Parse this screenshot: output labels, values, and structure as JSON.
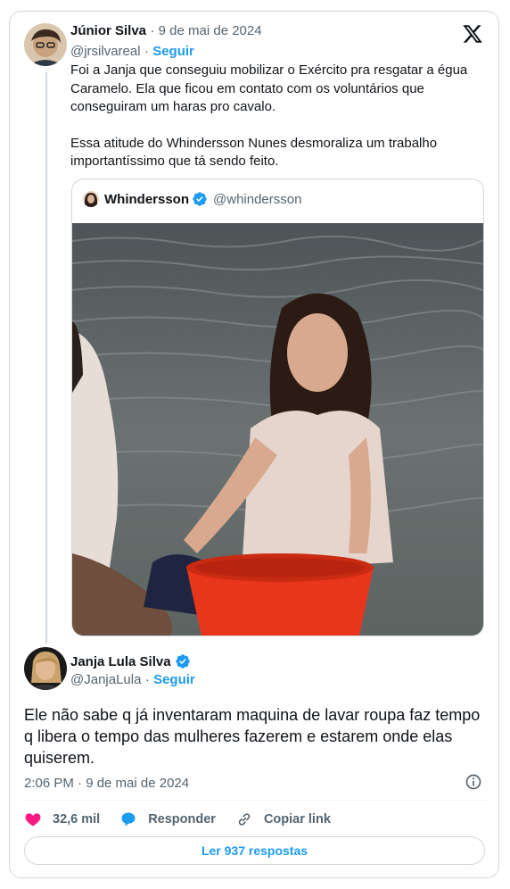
{
  "parent_tweet": {
    "author_name": "Júnior Silva",
    "date": "9 de mai de 2024",
    "handle": "@jrsilvareal",
    "follow_label": "Seguir",
    "paragraphs": [
      "Foi a Janja que conseguiu mobilizar o Exército pra resgatar a égua Caramelo. Ela que ficou em contato com os voluntários que conseguiram um haras pro cavalo.",
      "Essa atitude do Whindersson Nunes desmoraliza um trabalho importantíssimo que tá sendo feito."
    ],
    "quoted": {
      "author_name": "Whindersson",
      "handle": "@whindersson"
    }
  },
  "main_tweet": {
    "author_name": "Janja Lula Silva",
    "handle": "@JanjaLula",
    "follow_label": "Seguir",
    "text": "Ele não sabe q já inventaram maquina de lavar roupa faz tempo q libera o tempo das mulheres fazerem e estarem onde elas quiserem.",
    "timestamp": "2:06 PM · 9 de mai de 2024",
    "likes": "32,6 mil",
    "reply_label": "Responder",
    "copy_link_label": "Copiar link",
    "read_replies_label": "Ler 937 respostas"
  },
  "icons": {
    "brand": "x-logo-icon",
    "verified": "verified-badge-icon",
    "like": "heart-icon",
    "reply": "speech-bubble-icon",
    "copy": "link-icon",
    "info": "info-icon"
  },
  "colors": {
    "accent": "#1d9bf0",
    "like": "#f91880",
    "text": "#0f1419",
    "muted": "#536471",
    "border": "#cfd9de"
  }
}
